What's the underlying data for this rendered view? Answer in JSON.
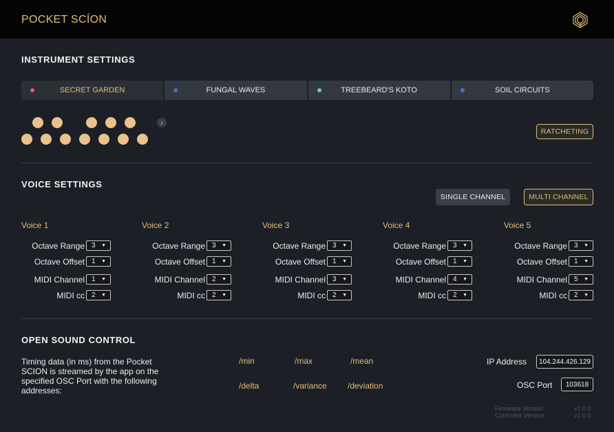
{
  "app": {
    "title": "POCKET SCÍON",
    "logo_icon": "mushroom-logo-icon"
  },
  "instrument": {
    "title": "INSTRUMENT SETTINGS",
    "tabs": [
      {
        "label": "SECRET GARDEN",
        "dot_color": "#e85a62",
        "active": true
      },
      {
        "label": "FUNGAL WAVES",
        "dot_color": "#4a6ed6",
        "active": false
      },
      {
        "label": "TREEBEARD'S KOTO",
        "dot_color": "#5fc9d6",
        "active": false
      },
      {
        "label": "SOIL CIRCUITS",
        "dot_color": "#4a6ed6",
        "active": false
      }
    ],
    "note_icon": "music-note-icon",
    "ratcheting_label": "RATCHETING"
  },
  "voice": {
    "title": "VOICE SETTINGS",
    "single_channel_label": "SINGLE CHANNEL",
    "multi_channel_label": "MULTI CHANNEL",
    "row_labels": {
      "octave_range": "Octave Range",
      "octave_offset": "Octave Offset",
      "midi_channel": "MIDI Channel",
      "midi_cc": "MIDI cc"
    },
    "voices": [
      {
        "name": "Voice 1",
        "octave_range": "3",
        "octave_offset": "1",
        "midi_channel": "1",
        "midi_cc": "2"
      },
      {
        "name": "Voice 2",
        "octave_range": "3",
        "octave_offset": "1",
        "midi_channel": "2",
        "midi_cc": "2"
      },
      {
        "name": "Voice 3",
        "octave_range": "3",
        "octave_offset": "1",
        "midi_channel": "3",
        "midi_cc": "2"
      },
      {
        "name": "Voice 4",
        "octave_range": "3",
        "octave_offset": "1",
        "midi_channel": "4",
        "midi_cc": "2"
      },
      {
        "name": "Voice 5",
        "octave_range": "3",
        "octave_offset": "1",
        "midi_channel": "5",
        "midi_cc": "2"
      }
    ],
    "caret": "▼"
  },
  "osc": {
    "title": "OPEN SOUND CONTROL",
    "description": "Timing data (in ms) from the Pocket SCION is streamed by the app on the specified OSC Port with the following addresses:",
    "addresses": [
      "/min",
      "/max",
      "/mean",
      "/delta",
      "/variance",
      "/deviation"
    ],
    "ip_label": "IP Address",
    "ip_value": "104.244.426.129",
    "port_label": "OSC Port",
    "port_value": "103618",
    "firmware_label": "Firmware Version",
    "firmware_value": "v1.0.0",
    "controller_label": "Controller Version",
    "controller_value": "v1.0.0"
  },
  "colors": {
    "accent": "#e3bd7c",
    "background": "#1c1f25",
    "topbar": "#050505",
    "step": "#e8c38d"
  }
}
